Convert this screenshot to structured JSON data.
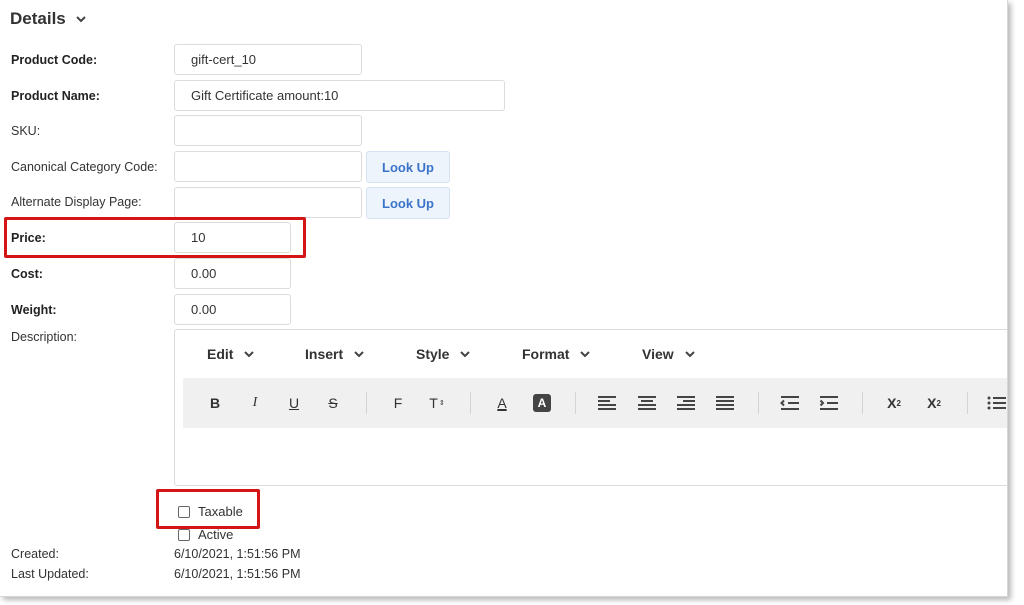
{
  "section": {
    "title": "Details",
    "icon": "chevron-down-icon"
  },
  "fields": {
    "product_code": {
      "label": "Product Code:",
      "value": "gift-cert_10"
    },
    "product_name": {
      "label": "Product Name:",
      "value": "Gift Certificate amount:10"
    },
    "sku": {
      "label": "SKU:",
      "value": ""
    },
    "canonical_category_code": {
      "label": "Canonical Category Code:",
      "value": "",
      "button": "Look Up"
    },
    "alternate_display_page": {
      "label": "Alternate Display Page:",
      "value": "",
      "button": "Look Up"
    },
    "price": {
      "label": "Price:",
      "value": "10"
    },
    "cost": {
      "label": "Cost:",
      "value": "0.00"
    },
    "weight": {
      "label": "Weight:",
      "value": "0.00"
    },
    "description": {
      "label": "Description:"
    }
  },
  "editor": {
    "menus": [
      "Edit",
      "Insert",
      "Style",
      "Format",
      "View"
    ],
    "tools": {
      "bold": "B",
      "italic": "I",
      "underline": "U",
      "strikethrough": "S",
      "font_family": "F",
      "font_size": "T",
      "text_color": "A",
      "background_color": "A",
      "superscript": "X",
      "subscript": "X"
    }
  },
  "checkboxes": {
    "taxable": {
      "label": "Taxable",
      "checked": false
    },
    "active": {
      "label": "Active",
      "checked": false
    }
  },
  "meta": {
    "created_label": "Created:",
    "created_value": "6/10/2021, 1:51:56 PM",
    "updated_label": "Last Updated:",
    "updated_value": "6/10/2021, 1:51:56 PM"
  },
  "colors": {
    "highlight": "#d31515",
    "link_blue": "#3b73c8",
    "button_bg": "#eef4fc"
  }
}
